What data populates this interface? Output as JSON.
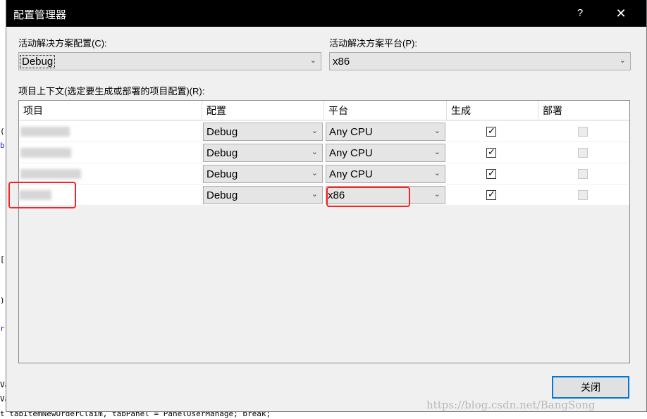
{
  "dialog": {
    "title": "配置管理器",
    "help_glyph": "?",
    "close_glyph": "✕"
  },
  "active_config": {
    "label": "活动解决方案配置(C):",
    "value": "Debug"
  },
  "active_platform": {
    "label": "活动解决方案平台(P):",
    "value": "x86"
  },
  "project_context_label": "项目上下文(选定要生成或部署的项目配置)(R):",
  "grid": {
    "headers": [
      "项目",
      "配置",
      "平台",
      "生成",
      "部署"
    ],
    "rows": [
      {
        "config": "Debug",
        "platform": "Any CPU",
        "build": true,
        "deploy": false
      },
      {
        "config": "Debug",
        "platform": "Any CPU",
        "build": true,
        "deploy": false
      },
      {
        "config": "Debug",
        "platform": "Any CPU",
        "build": true,
        "deploy": false
      },
      {
        "config": "Debug",
        "platform": "x86",
        "build": true,
        "deploy": false
      }
    ]
  },
  "buttons": {
    "close_label": "关闭"
  },
  "icons": {
    "dropdown": "chevron-down-icon",
    "check": "checkmark-icon"
  },
  "symbols": {
    "chevron": "⌄",
    "check": "✓"
  },
  "background": {
    "code_line": "t tabItemNewOrderClaim, tabPanel = PanelUserManage; break;",
    "fragments": [
      "()",
      "b",
      "[]",
      ")",
      "r",
      "Va",
      "Va"
    ]
  },
  "watermark": "https://blog.csdn.net/BangSong",
  "colors": {
    "accent": "#0078d7",
    "highlight": "#ff2020",
    "titlebar": "#000000"
  }
}
